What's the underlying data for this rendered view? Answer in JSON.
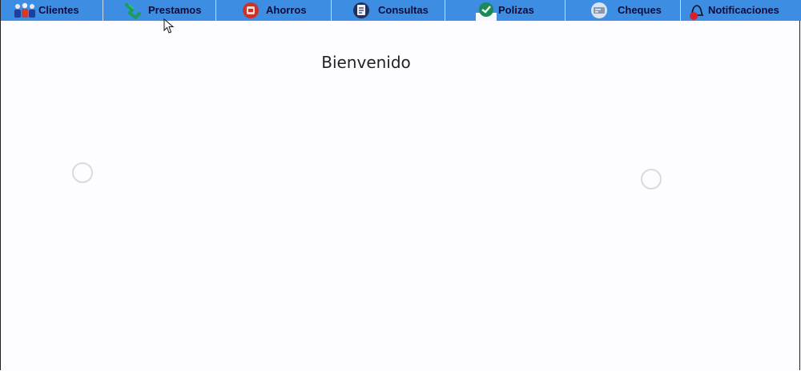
{
  "menu": {
    "items": [
      {
        "label": "Clientes",
        "icon": "users-icon"
      },
      {
        "label": "Prestamos",
        "icon": "money-icon"
      },
      {
        "label": "Ahorros",
        "icon": "piggy-bank-icon"
      },
      {
        "label": "Consultas",
        "icon": "document-icon"
      },
      {
        "label": "Polizas",
        "icon": "policy-icon"
      },
      {
        "label": "Cheques",
        "icon": "cheque-icon"
      },
      {
        "label": "Notificaciones",
        "icon": "bell-icon"
      }
    ]
  },
  "main": {
    "welcome": "Bienvenido"
  },
  "colors": {
    "menubar": "#3d8de3",
    "background": "#fdfcfe"
  }
}
